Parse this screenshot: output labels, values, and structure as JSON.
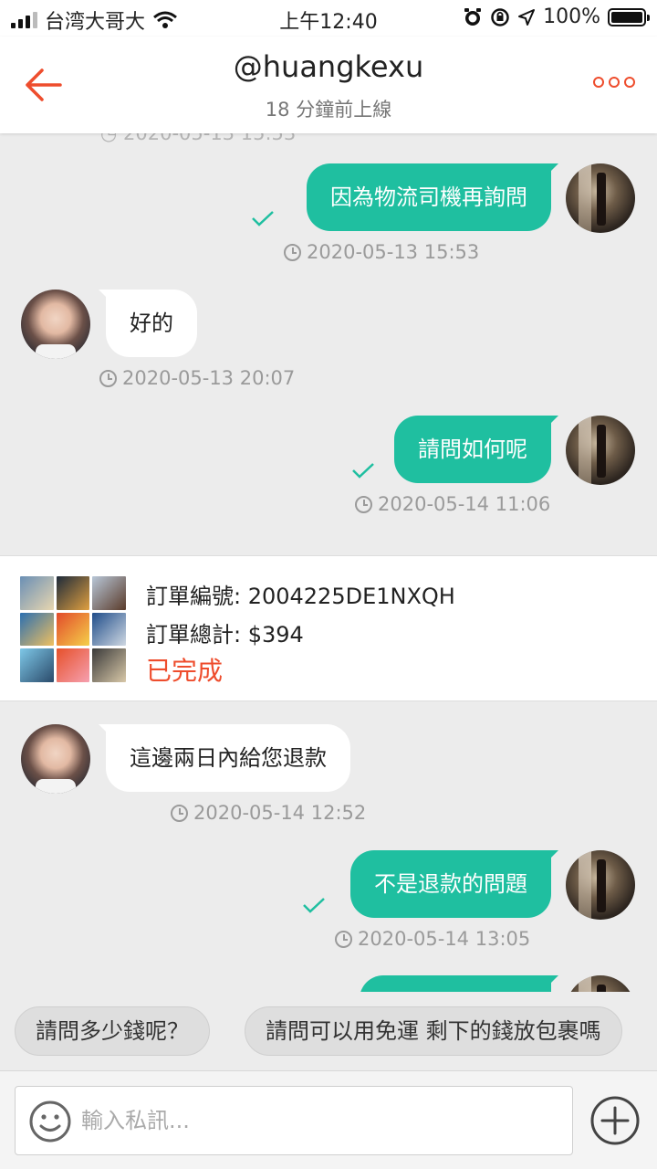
{
  "status_bar": {
    "carrier": "台湾大哥大",
    "time": "上午12:40",
    "battery": "100%"
  },
  "header": {
    "title": "@huangkexu",
    "subtitle": "18 分鐘前上線"
  },
  "messages": [
    {
      "side": "out",
      "text": "因為物流司機再詢問",
      "time": "2020-05-13 15:53"
    },
    {
      "side": "in",
      "text": "好的",
      "time": "2020-05-13 20:07"
    },
    {
      "side": "out",
      "text": "請問如何呢",
      "time": "2020-05-14 11:06"
    },
    {
      "side": "in",
      "text": "這邊兩日內給您退款",
      "time": "2020-05-14 12:52"
    },
    {
      "side": "out",
      "text": "不是退款的問題",
      "time": "2020-05-14 13:05"
    }
  ],
  "order": {
    "number_label": "訂單編號: 2004225DE1NXQH",
    "total_label": "訂單總計: $394",
    "status": "已完成"
  },
  "quick_replies": [
    "請問多少錢呢？",
    "請問可以用免運 剩下的錢放包裹嗎"
  ],
  "input": {
    "placeholder": "輸入私訊..."
  },
  "colors": {
    "accent": "#ee4d2d",
    "outgoing_bubble": "#1fbfa0",
    "incoming_bubble": "#ffffff",
    "background": "#ececec"
  }
}
